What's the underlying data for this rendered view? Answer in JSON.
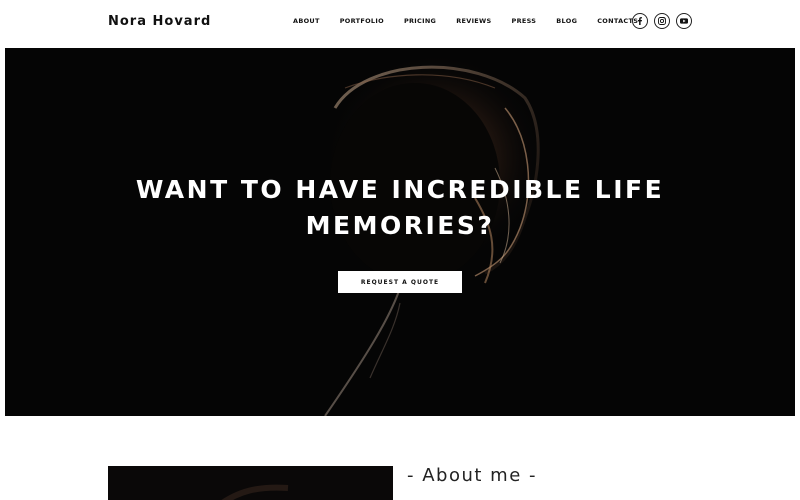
{
  "brand": {
    "name": "Nora Hovard"
  },
  "nav": {
    "items": [
      {
        "label": "ABOUT"
      },
      {
        "label": "PORTFOLIO"
      },
      {
        "label": "PRICING"
      },
      {
        "label": "REVIEWS"
      },
      {
        "label": "PRESS"
      },
      {
        "label": "BLOG"
      },
      {
        "label": "CONTACTS"
      }
    ]
  },
  "social": [
    {
      "icon": "facebook-icon"
    },
    {
      "icon": "instagram-icon"
    },
    {
      "icon": "youtube-icon"
    }
  ],
  "hero": {
    "title_line1": "WANT TO HAVE INCREDIBLE LIFE",
    "title_line2": "MEMORIES?",
    "cta_label": "REQUEST A QUOTE"
  },
  "about": {
    "title": "- About me -",
    "text": ""
  },
  "colors": {
    "hero_bg": "#050505",
    "text": "#111111",
    "button_bg": "#ffffff"
  }
}
